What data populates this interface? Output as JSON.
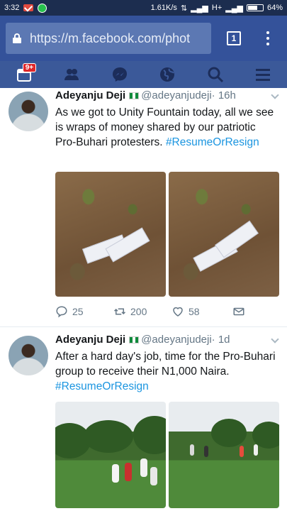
{
  "status_bar": {
    "time": "3:32",
    "speed": "1.61K/s",
    "network": "H+",
    "battery": "64%",
    "battery_level": 0.64
  },
  "browser": {
    "url": "https://m.facebook.com/phot",
    "tab_count": "1"
  },
  "fb_nav": {
    "notifications_badge": "9+",
    "items": [
      "notifications-icon",
      "friends-icon",
      "messenger-icon",
      "globe-icon",
      "search-icon",
      "menu-icon"
    ]
  },
  "tweets": [
    {
      "name": "Adeyanju Deji",
      "handle": "@adeyanjudeji",
      "time": "· 16h",
      "text": "As we got to Unity Fountain today, all we see is wraps of money shared by our patriotic Pro-Buhari protesters.",
      "hashtag": "#ResumeOrResign",
      "replies": "25",
      "retweets": "200",
      "likes": "58"
    },
    {
      "name": "Adeyanju Deji",
      "handle": "@adeyanjudeji",
      "time": "· 1d",
      "text": "After a hard day's job, time for the Pro-Buhari group to receive their N1,000 Naira.",
      "hashtag": "#ResumeOrResign"
    }
  ],
  "colors": {
    "status_bar": "#1c2d4f",
    "browser_bar": "#34529a",
    "facebook_nav": "#3b5999",
    "hashtag": "#1b95e0"
  }
}
